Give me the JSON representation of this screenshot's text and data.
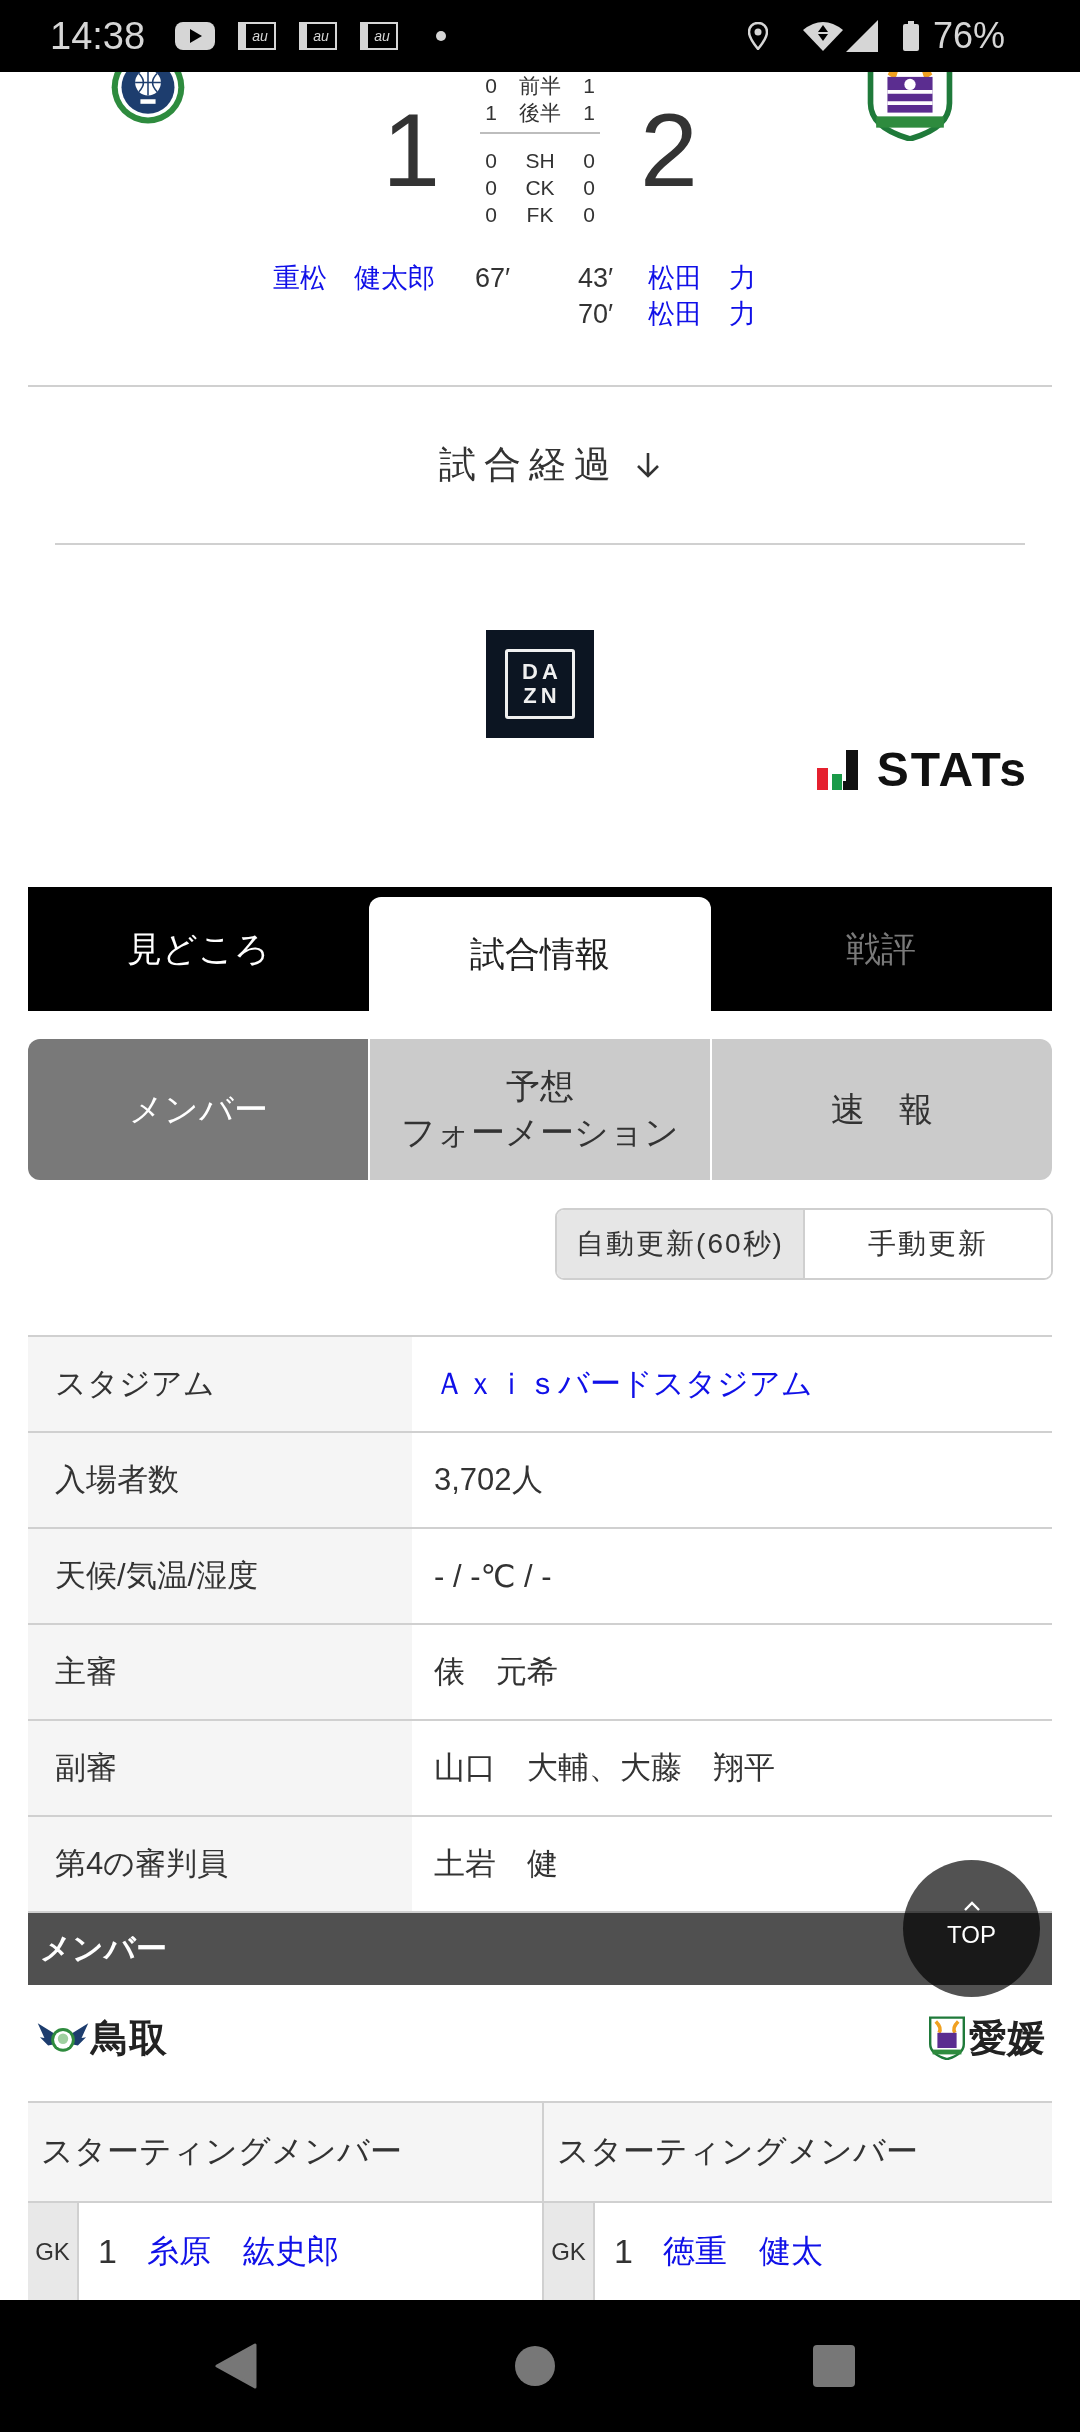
{
  "status_bar": {
    "time": "14:38",
    "carrier_notifications": [
      "au",
      "au",
      "au"
    ],
    "battery": "76%"
  },
  "match": {
    "home": {
      "score": "1",
      "goals": [
        {
          "player": "重松　健太郎",
          "minute": "67′"
        }
      ]
    },
    "away": {
      "score": "2",
      "goals": [
        {
          "minute": "43′",
          "player": "松田　力"
        },
        {
          "minute": "70′",
          "player": "松田　力"
        }
      ]
    },
    "periods": [
      {
        "home": "0",
        "label": "前半",
        "away": "1"
      },
      {
        "home": "1",
        "label": "後半",
        "away": "1"
      }
    ],
    "stats": [
      {
        "home": "0",
        "label": "SH",
        "away": "0"
      },
      {
        "home": "0",
        "label": "CK",
        "away": "0"
      },
      {
        "home": "0",
        "label": "FK",
        "away": "0"
      }
    ]
  },
  "progress_toggle": {
    "label": "試合経過"
  },
  "broadcaster_logo": {
    "lines": [
      "DA",
      "ZN"
    ]
  },
  "stats_logo": {
    "text": "STATs"
  },
  "tabs": [
    {
      "label": "見どころ",
      "selected": false,
      "disabled": false
    },
    {
      "label": "試合情報",
      "selected": true,
      "disabled": false
    },
    {
      "label": "戦評",
      "selected": false,
      "disabled": true
    }
  ],
  "sub_tabs": [
    {
      "label_lines": [
        "メンバー"
      ],
      "selected": true
    },
    {
      "label_lines": [
        "予想",
        "フォーメーション"
      ],
      "selected": false
    },
    {
      "label_lines": [
        "速　報"
      ],
      "selected": false
    }
  ],
  "update_modes": [
    {
      "label": "自動更新(60秒)",
      "selected": true
    },
    {
      "label": "手動更新",
      "selected": false
    }
  ],
  "info_table": [
    {
      "label": "スタジアム",
      "value": "Ａｘｉｓバードスタジアム",
      "kind": "link"
    },
    {
      "label": "入場者数",
      "value": "3,702人",
      "kind": "text"
    },
    {
      "label": "天候/気温/湿度",
      "value": "- / -℃ / -",
      "kind": "text"
    },
    {
      "label": "主審",
      "value": "俵　元希",
      "kind": "text"
    },
    {
      "label": "副審",
      "value": "山口　大輔、大藤　翔平",
      "kind": "text"
    },
    {
      "label": "第4の審判員",
      "value": "土岩　健",
      "kind": "text"
    }
  ],
  "members": {
    "title": "メンバー",
    "home_team": "鳥取",
    "away_team": "愛媛",
    "home_lineup": {
      "heading": "スターティングメンバー",
      "players": [
        {
          "position": "GK",
          "number": "1",
          "name": "糸原　紘史郎"
        }
      ]
    },
    "away_lineup": {
      "heading": "スターティングメンバー",
      "players": [
        {
          "position": "GK",
          "number": "1",
          "name": "徳重　健太"
        }
      ]
    }
  },
  "top_button": {
    "label": "TOP"
  }
}
